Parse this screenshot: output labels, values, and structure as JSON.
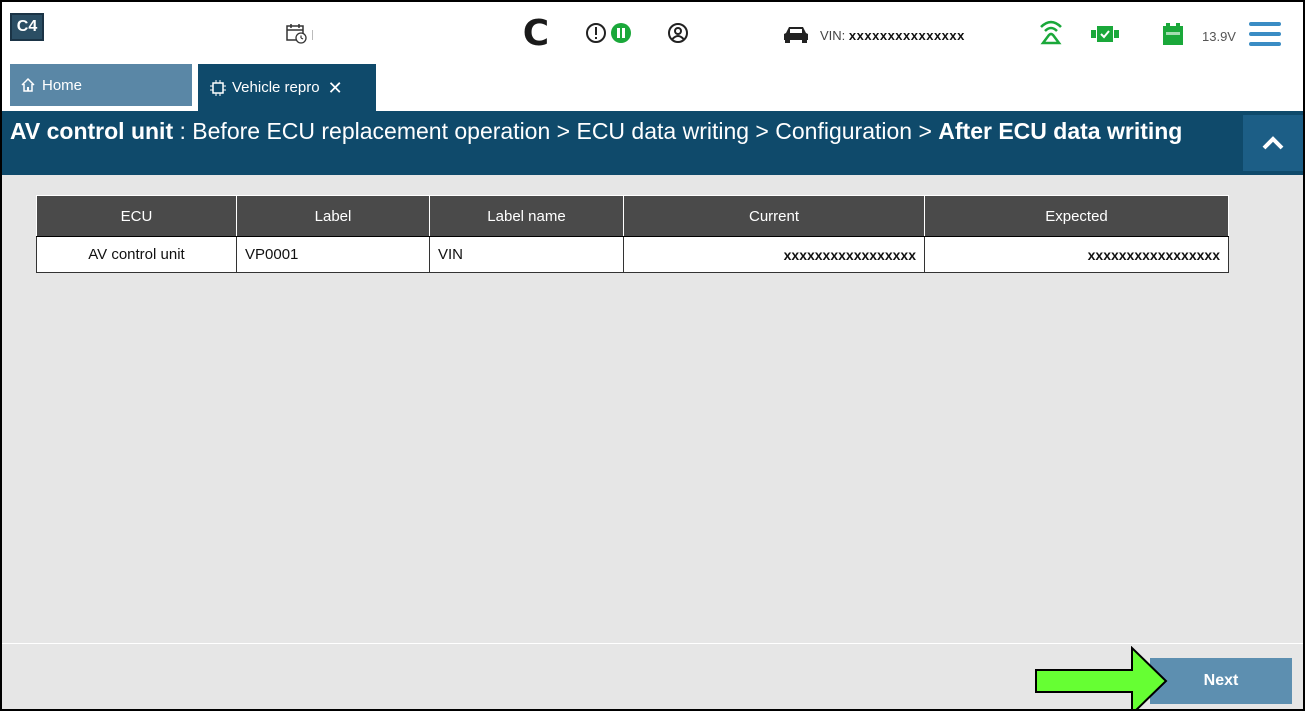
{
  "app": {
    "logo_text": "C4"
  },
  "status": {
    "vin_label": "VIN:",
    "vin_value": "xxxxxxxxxxxxxxx",
    "voltage": "13.9V",
    "accent_color": "#3a8cc4",
    "ok_color": "#1aa83a"
  },
  "tabs": [
    {
      "label": "Home",
      "icon": "home-icon"
    },
    {
      "label": "Vehicle repro",
      "icon": "chip-icon"
    }
  ],
  "breadcrumb": {
    "ecu": "AV control unit",
    "path": " : Before ECU replacement operation > ECU data writing > Configuration > ",
    "current": "After ECU data writing"
  },
  "table": {
    "headers": [
      "ECU",
      "Label",
      "Label name",
      "Current",
      "Expected"
    ],
    "rows": [
      [
        "AV control unit",
        "VP0001",
        "VIN",
        "xxxxxxxxxxxxxxxxx",
        "xxxxxxxxxxxxxxxxx"
      ]
    ]
  },
  "footer": {
    "next_label": "Next"
  }
}
